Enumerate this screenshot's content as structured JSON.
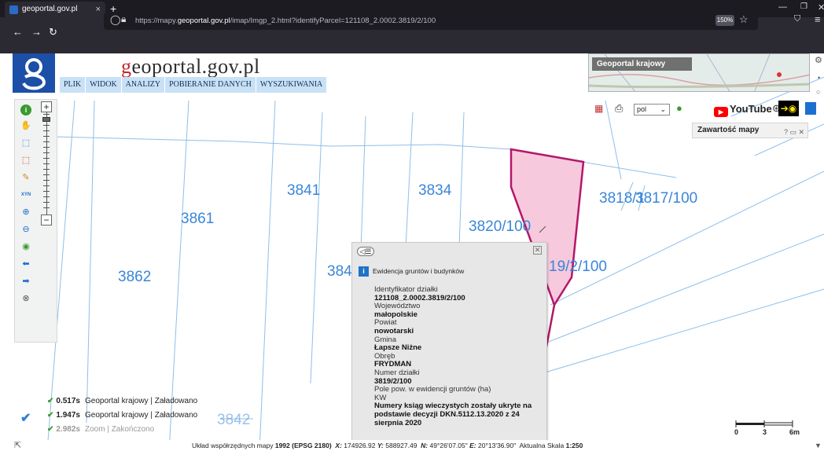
{
  "browser": {
    "tab_title": "geoportal.gov.pl",
    "tab_close": "×",
    "new_tab": "+",
    "url_prefix": "https://mapy.",
    "url_domain": "geoportal.gov.pl",
    "url_rest": "/imap/Imgp_2.html?identifyParcel=121108_2.0002.3819/2/100",
    "zoom": "150%",
    "icons": [
      "back-arrow-icon",
      "forward-arrow-icon",
      "reload-icon",
      "shield-icon",
      "lock-icon",
      "star-icon",
      "pocket-icon",
      "hamburger-menu-icon"
    ]
  },
  "header": {
    "site_title_g": "g",
    "site_title_rest": "eoportal.gov.pl",
    "menu": [
      "PLIK",
      "WIDOK",
      "ANALIZY",
      "POBIERANIE DANYCH",
      "WYSZUKIWANIA"
    ],
    "mini_map_title": "Geoportal krajowy",
    "language": "pol",
    "youtube_label": "YouTube",
    "contents_title": "Zawartość mapy",
    "contents_controls": "? ▭ ✕"
  },
  "map": {
    "selected_parcel_color": "#b3176a",
    "selected_parcel_fill": "#f7c9dc",
    "parcel_line_color": "#8fbfe8",
    "labels": [
      "3841",
      "3834",
      "3861",
      "3820/100",
      "3818/1",
      "3817/100",
      "3862",
      "384",
      "19/2/100",
      "3842"
    ]
  },
  "popup": {
    "back_label": "◁☰",
    "close_label": "✕",
    "header": "Ewidencja gruntów i budynków",
    "fields": [
      {
        "label": "Identyfikator działki",
        "value": "121108_2.0002.3819/2/100"
      },
      {
        "label": "Województwo",
        "value": "małopolskie"
      },
      {
        "label": "Powiat",
        "value": "nowotarski"
      },
      {
        "label": "Gmina",
        "value": "Łapsze Niżne"
      },
      {
        "label": "Obręb",
        "value": "FRYDMAN"
      },
      {
        "label": "Numer działki",
        "value": "3819/2/100"
      },
      {
        "label": "Pole pow. w ewidencji gruntów (ha)",
        "value": ""
      },
      {
        "label": "KW",
        "value": "Numery ksiąg wieczystych zostały ukryte na podstawie decyzji DKN.5112.13.2020 z 24 sierpnia 2020"
      }
    ]
  },
  "status_log": [
    {
      "time": "0.517s",
      "source": "Geoportal krajowy",
      "state": "Załadowano",
      "dim": false
    },
    {
      "time": "1.947s",
      "source": "Geoportal krajowy",
      "state": "Załadowano",
      "dim": false
    },
    {
      "time": "2.982s",
      "source": "Zoom",
      "state": "Zakończono",
      "dim": true
    }
  ],
  "scale": {
    "ticks": [
      "0",
      "3",
      "6m"
    ]
  },
  "coords": {
    "system_label": "Układ współrzędnych mapy",
    "system_value": "1992 (EPSG 2180)",
    "x_label": "X:",
    "x_value": "174926.92",
    "y_label": "Y:",
    "y_value": "588927.49",
    "n_label": "N:",
    "n_value": "49°26'07.05\"",
    "e_label": "E:",
    "e_value": "20°13'36.90\"",
    "scale_label": "Aktualna Skala",
    "scale_value": "1:250"
  }
}
